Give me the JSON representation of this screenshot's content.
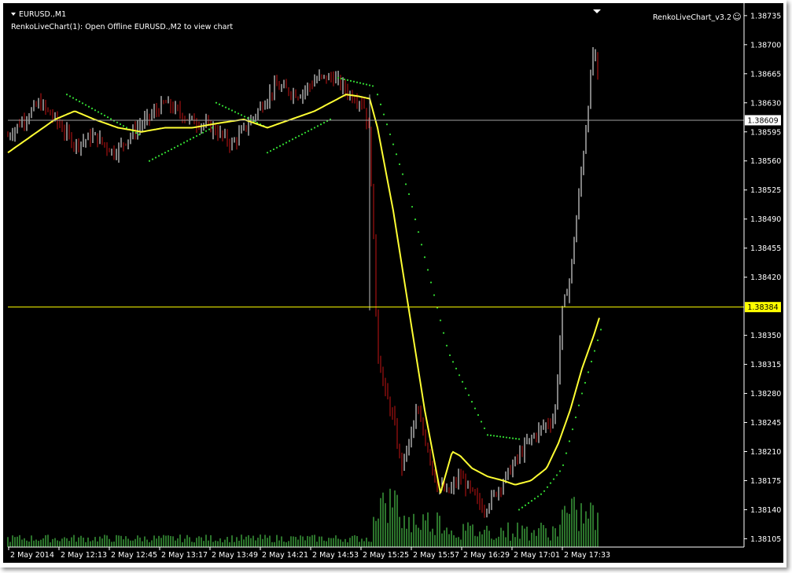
{
  "header": {
    "symbol": "EURUSD.,M1",
    "indicator_line": "RenkoLiveChart(1): Open Offline EURUSD.,M2 to view chart",
    "ea_label": "RenkoLiveChart_v3.2",
    "smiley": "☺"
  },
  "colors": {
    "background": "#000000",
    "bull": "#ffffff",
    "bear": "#c41414",
    "ma_yellow": "#ffff33",
    "psar_green": "#33dd33",
    "volume": "#3a9a3a",
    "bid_line": "#a0a0a0",
    "level_line": "#ffff00",
    "axis": "#ffffff"
  },
  "chart_data": {
    "type": "candlestick",
    "symbol": "EURUSD.",
    "timeframe": "M1",
    "yticks": [
      "1.38735",
      "1.38700",
      "1.38665",
      "1.38630",
      "1.38595",
      "1.38560",
      "1.38525",
      "1.38490",
      "1.38455",
      "1.38420",
      "1.38350",
      "1.38315",
      "1.38280",
      "1.38245",
      "1.38210",
      "1.38175",
      "1.38140",
      "1.38105"
    ],
    "xticks": [
      "2 May 2014",
      "2 May 12:13",
      "2 May 12:45",
      "2 May 13:17",
      "2 May 13:49",
      "2 May 14:21",
      "2 May 14:53",
      "2 May 15:25",
      "2 May 15:57",
      "2 May 16:29",
      "2 May 17:01",
      "2 May 17:33"
    ],
    "ylim": [
      1.38095,
      1.3875
    ],
    "bid_price": "1.38609",
    "level_price": "1.38384",
    "series": [
      {
        "name": "price",
        "anchors": [
          [
            0,
            1.3859
          ],
          [
            20,
            1.3861
          ],
          [
            40,
            1.3863
          ],
          [
            60,
            1.3861
          ],
          [
            85,
            1.3858
          ],
          [
            110,
            1.3859
          ],
          [
            135,
            1.3857
          ],
          [
            165,
            1.386
          ],
          [
            200,
            1.3863
          ],
          [
            230,
            1.3861
          ],
          [
            260,
            1.386
          ],
          [
            285,
            1.3858
          ],
          [
            310,
            1.3861
          ],
          [
            340,
            1.3865
          ],
          [
            370,
            1.3864
          ],
          [
            395,
            1.3866
          ],
          [
            415,
            1.3866
          ],
          [
            435,
            1.3864
          ],
          [
            452,
            1.3863
          ],
          [
            460,
            1.3859
          ],
          [
            470,
            1.3833
          ],
          [
            480,
            1.3828
          ],
          [
            490,
            1.3825
          ],
          [
            500,
            1.3819
          ],
          [
            510,
            1.3822
          ],
          [
            520,
            1.3826
          ],
          [
            535,
            1.3821
          ],
          [
            545,
            1.3817
          ],
          [
            560,
            1.3816
          ],
          [
            575,
            1.3818
          ],
          [
            590,
            1.3816
          ],
          [
            605,
            1.3814
          ],
          [
            620,
            1.3816
          ],
          [
            640,
            1.3819
          ],
          [
            660,
            1.3822
          ],
          [
            680,
            1.3824
          ],
          [
            695,
            1.3825
          ],
          [
            705,
            1.3838
          ],
          [
            715,
            1.3842
          ],
          [
            725,
            1.3851
          ],
          [
            735,
            1.386
          ],
          [
            745,
            1.387
          ],
          [
            755,
            1.3862
          ]
        ]
      },
      {
        "name": "ma",
        "anchors": [
          [
            0,
            1.3857
          ],
          [
            30,
            1.3859
          ],
          [
            60,
            1.3861
          ],
          [
            85,
            1.3862
          ],
          [
            110,
            1.3861
          ],
          [
            140,
            1.386
          ],
          [
            170,
            1.38595
          ],
          [
            200,
            1.386
          ],
          [
            235,
            1.386
          ],
          [
            265,
            1.38605
          ],
          [
            300,
            1.3861
          ],
          [
            330,
            1.386
          ],
          [
            360,
            1.3861
          ],
          [
            390,
            1.3862
          ],
          [
            410,
            1.3863
          ],
          [
            430,
            1.3864
          ],
          [
            445,
            1.38638
          ],
          [
            460,
            1.38635
          ],
          [
            470,
            1.386
          ],
          [
            490,
            1.385
          ],
          [
            510,
            1.3838
          ],
          [
            530,
            1.3826
          ],
          [
            550,
            1.3816
          ],
          [
            565,
            1.3821
          ],
          [
            575,
            1.38205
          ],
          [
            590,
            1.3819
          ],
          [
            610,
            1.3818
          ],
          [
            630,
            1.38175
          ],
          [
            645,
            1.3817
          ],
          [
            665,
            1.38175
          ],
          [
            685,
            1.3819
          ],
          [
            700,
            1.3822
          ],
          [
            715,
            1.3826
          ],
          [
            730,
            1.3831
          ],
          [
            745,
            1.3835
          ],
          [
            755,
            1.3838
          ]
        ]
      },
      {
        "name": "psar",
        "segments": [
          [
            [
              75,
              1.3864
            ],
            [
              170,
              1.3859
            ]
          ],
          [
            [
              180,
              1.3856
            ],
            [
              260,
              1.386
            ]
          ],
          [
            [
              265,
              1.3863
            ],
            [
              330,
              1.386
            ]
          ],
          [
            [
              330,
              1.3857
            ],
            [
              410,
              1.3861
            ]
          ],
          [
            [
              420,
              1.3866
            ],
            [
              465,
              1.3865
            ]
          ],
          [
            [
              470,
              1.3864
            ],
            [
              510,
              1.3852
            ],
            [
              560,
              1.3833
            ],
            [
              610,
              1.3823
            ],
            [
              650,
              1.38225
            ]
          ],
          [
            [
              650,
              1.3814
            ],
            [
              680,
              1.3816
            ],
            [
              705,
              1.3819
            ],
            [
              730,
              1.3828
            ],
            [
              755,
              1.3836
            ]
          ]
        ]
      }
    ]
  }
}
